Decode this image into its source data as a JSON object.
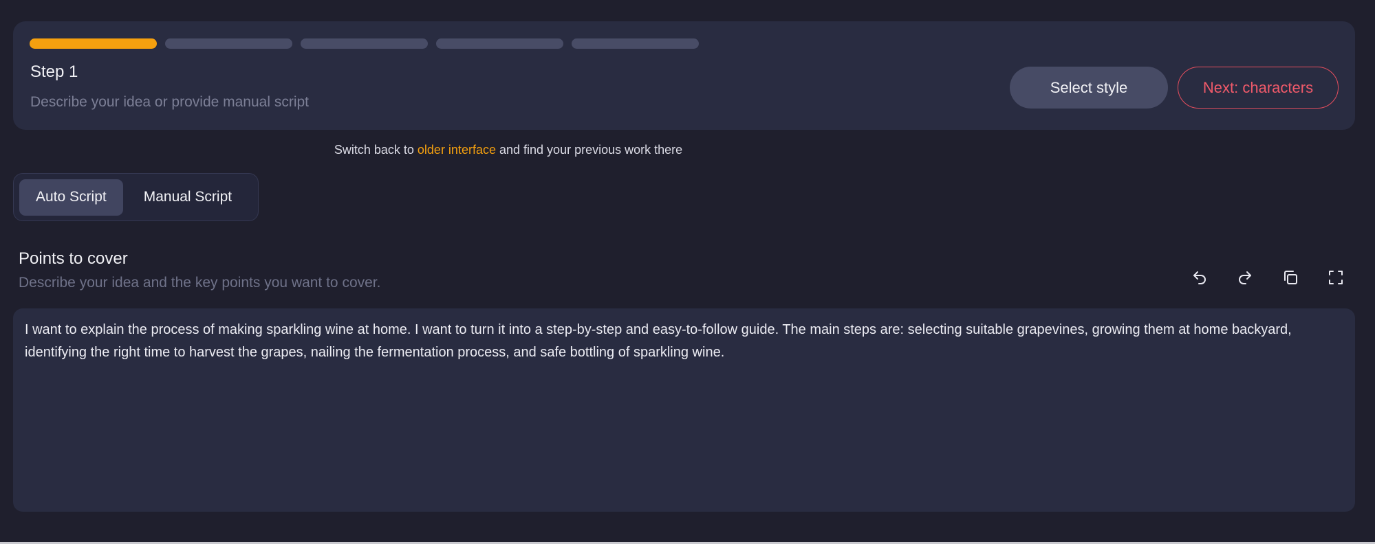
{
  "progress": {
    "total_steps": 5,
    "current_step": 1
  },
  "step": {
    "title": "Step 1",
    "description": "Describe your idea or provide manual script",
    "select_style_label": "Select style",
    "next_label": "Next: characters"
  },
  "switch_notice": {
    "prefix": "Switch back to",
    "link": "older interface",
    "suffix": "and find your previous work there"
  },
  "script_tabs": [
    {
      "label": "Auto Script",
      "active": true
    },
    {
      "label": "Manual Script",
      "active": false
    }
  ],
  "points": {
    "title": "Points to cover",
    "description": "Describe your idea and the key points you want to cover.",
    "content": "I want to explain the process of making sparkling wine at home. I want to turn it into a step-by-step and easy-to-follow guide. The main steps are: selecting suitable grapevines, growing them at home backyard, identifying the right time to harvest the grapes, nailing the fermentation process, and safe bottling of sparkling wine."
  },
  "toolbar": {
    "icons": [
      "undo-icon",
      "redo-icon",
      "copy-icon",
      "fullscreen-icon"
    ]
  },
  "colors": {
    "accent": "#f5a00f",
    "next_button": "#f05a6a",
    "background": "#1f1f2d",
    "card": "#292c41"
  }
}
